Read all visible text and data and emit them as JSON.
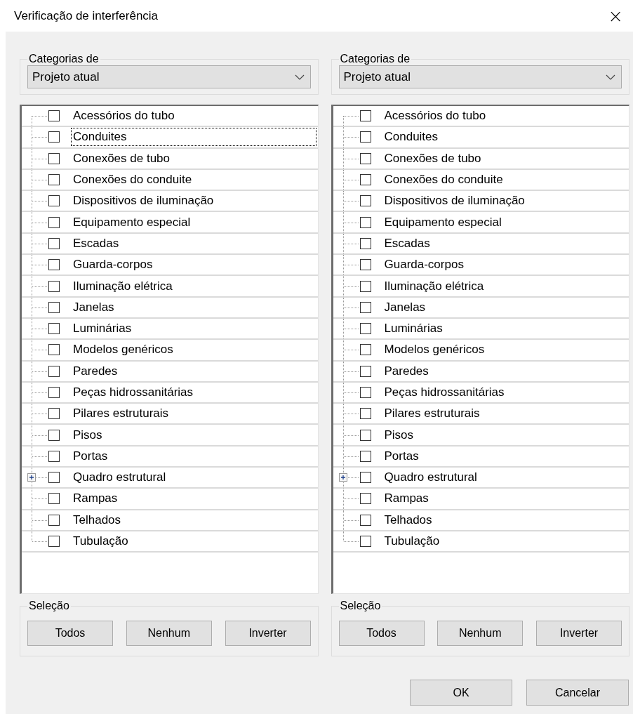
{
  "window": {
    "title": "Verificação de interferência",
    "close": "×"
  },
  "panels": [
    {
      "group_label": "Categorias de",
      "source": "Projeto atual",
      "items": [
        {
          "label": "Acessórios do tubo",
          "kind": "leaf",
          "checked": false,
          "focused": false
        },
        {
          "label": "Conduites",
          "kind": "leaf",
          "checked": false,
          "focused": true
        },
        {
          "label": "Conexões de tubo",
          "kind": "leaf",
          "checked": false,
          "focused": false
        },
        {
          "label": "Conexões do conduite",
          "kind": "leaf",
          "checked": false,
          "focused": false
        },
        {
          "label": "Dispositivos de iluminação",
          "kind": "leaf",
          "checked": false,
          "focused": false
        },
        {
          "label": "Equipamento especial",
          "kind": "leaf",
          "checked": false,
          "focused": false
        },
        {
          "label": "Escadas",
          "kind": "leaf",
          "checked": false,
          "focused": false
        },
        {
          "label": "Guarda-corpos",
          "kind": "leaf",
          "checked": false,
          "focused": false
        },
        {
          "label": "Iluminação elétrica",
          "kind": "leaf",
          "checked": false,
          "focused": false
        },
        {
          "label": "Janelas",
          "kind": "leaf",
          "checked": false,
          "focused": false
        },
        {
          "label": "Luminárias",
          "kind": "leaf",
          "checked": false,
          "focused": false
        },
        {
          "label": "Modelos genéricos",
          "kind": "leaf",
          "checked": false,
          "focused": false
        },
        {
          "label": "Paredes",
          "kind": "leaf",
          "checked": false,
          "focused": false
        },
        {
          "label": "Peças hidrossanitárias",
          "kind": "leaf",
          "checked": false,
          "focused": false
        },
        {
          "label": "Pilares estruturais",
          "kind": "leaf",
          "checked": false,
          "focused": false
        },
        {
          "label": "Pisos",
          "kind": "leaf",
          "checked": false,
          "focused": false
        },
        {
          "label": "Portas",
          "kind": "leaf",
          "checked": false,
          "focused": false
        },
        {
          "label": "Quadro estrutural",
          "kind": "group",
          "checked": false,
          "focused": false
        },
        {
          "label": "Rampas",
          "kind": "leaf",
          "checked": false,
          "focused": false
        },
        {
          "label": "Telhados",
          "kind": "leaf",
          "checked": false,
          "focused": false
        },
        {
          "label": "Tubulação",
          "kind": "leaf",
          "checked": false,
          "focused": false
        }
      ],
      "selection_label": "Seleção",
      "selection_buttons": [
        "Todos",
        "Nenhum",
        "Inverter"
      ]
    },
    {
      "group_label": "Categorias de",
      "source": "Projeto atual",
      "items": [
        {
          "label": "Acessórios do tubo",
          "kind": "leaf",
          "checked": false,
          "focused": false
        },
        {
          "label": "Conduites",
          "kind": "leaf",
          "checked": false,
          "focused": false
        },
        {
          "label": "Conexões de tubo",
          "kind": "leaf",
          "checked": false,
          "focused": false
        },
        {
          "label": "Conexões do conduite",
          "kind": "leaf",
          "checked": false,
          "focused": false
        },
        {
          "label": "Dispositivos de iluminação",
          "kind": "leaf",
          "checked": false,
          "focused": false
        },
        {
          "label": "Equipamento especial",
          "kind": "leaf",
          "checked": false,
          "focused": false
        },
        {
          "label": "Escadas",
          "kind": "leaf",
          "checked": false,
          "focused": false
        },
        {
          "label": "Guarda-corpos",
          "kind": "leaf",
          "checked": false,
          "focused": false
        },
        {
          "label": "Iluminação elétrica",
          "kind": "leaf",
          "checked": false,
          "focused": false
        },
        {
          "label": "Janelas",
          "kind": "leaf",
          "checked": false,
          "focused": false
        },
        {
          "label": "Luminárias",
          "kind": "leaf",
          "checked": false,
          "focused": false
        },
        {
          "label": "Modelos genéricos",
          "kind": "leaf",
          "checked": false,
          "focused": false
        },
        {
          "label": "Paredes",
          "kind": "leaf",
          "checked": false,
          "focused": false
        },
        {
          "label": "Peças hidrossanitárias",
          "kind": "leaf",
          "checked": false,
          "focused": false
        },
        {
          "label": "Pilares estruturais",
          "kind": "leaf",
          "checked": false,
          "focused": false
        },
        {
          "label": "Pisos",
          "kind": "leaf",
          "checked": false,
          "focused": false
        },
        {
          "label": "Portas",
          "kind": "leaf",
          "checked": false,
          "focused": false
        },
        {
          "label": "Quadro estrutural",
          "kind": "group",
          "checked": false,
          "focused": false
        },
        {
          "label": "Rampas",
          "kind": "leaf",
          "checked": false,
          "focused": false
        },
        {
          "label": "Telhados",
          "kind": "leaf",
          "checked": false,
          "focused": false
        },
        {
          "label": "Tubulação",
          "kind": "leaf",
          "checked": false,
          "focused": false
        }
      ],
      "selection_label": "Seleção",
      "selection_buttons": [
        "Todos",
        "Nenhum",
        "Inverter"
      ]
    }
  ],
  "buttons": [
    "OK",
    "Cancelar"
  ]
}
